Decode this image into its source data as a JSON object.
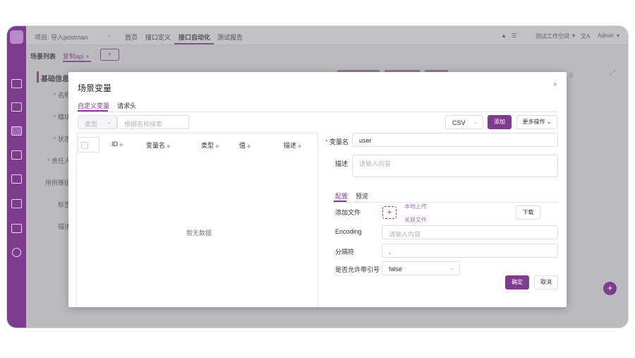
{
  "topbar": {
    "project": "项目: 导入postman",
    "nav": [
      "首页",
      "接口定义",
      "接口自动化",
      "测试报告"
    ],
    "active_nav": "接口自动化",
    "workspace": "测试工作空间",
    "user": "Admin"
  },
  "tabs": {
    "scenario_list": "场景列表",
    "copy_api": "复制api",
    "close_glyph": "×",
    "add_glyph": "+"
  },
  "left_form": {
    "title": "基础信息",
    "fields": [
      {
        "label": "名称",
        "required": true
      },
      {
        "label": "模块",
        "required": true
      },
      {
        "label": "状态",
        "required": true
      },
      {
        "label": "责任人",
        "required": true
      },
      {
        "label": "用例等级",
        "required": false
      },
      {
        "label": "标签",
        "required": false
      },
      {
        "label": "描述",
        "required": false
      }
    ],
    "bg_right_value": "0"
  },
  "modal": {
    "title": "场景变量",
    "close_glyph": "×",
    "tabs": [
      "自定义变量",
      "请求头"
    ],
    "active_tab": "自定义变量",
    "filter": {
      "type_placeholder": "类型",
      "search_placeholder": "根据名称搜索"
    },
    "format_select": "CSV",
    "add_button": "添加",
    "more_actions": "更多操作",
    "table": {
      "columns": [
        "ID",
        "变量名",
        "类型",
        "值",
        "描述"
      ],
      "empty_text": "暂无数据"
    },
    "detail": {
      "var_name_label": "变量名",
      "var_name_value": "user",
      "desc_label": "描述",
      "desc_placeholder": "请输入内容",
      "subtabs": [
        "配置",
        "预览"
      ],
      "active_subtab": "配置",
      "add_file_label": "添加文件",
      "upload_menu": [
        "本地上传",
        "关联文件"
      ],
      "download_button": "下载",
      "encoding_label": "Encoding",
      "encoding_placeholder": "请输入内容",
      "delimiter_label": "分隔符",
      "delimiter_value": ",",
      "quote_label": "是否允许带引号",
      "quote_value": "false"
    },
    "confirm_button": "确定",
    "cancel_button": "取消"
  },
  "colors": {
    "accent": "#7d3c8e",
    "sidebar": "#7d3c8e",
    "required": "#e0475c"
  }
}
